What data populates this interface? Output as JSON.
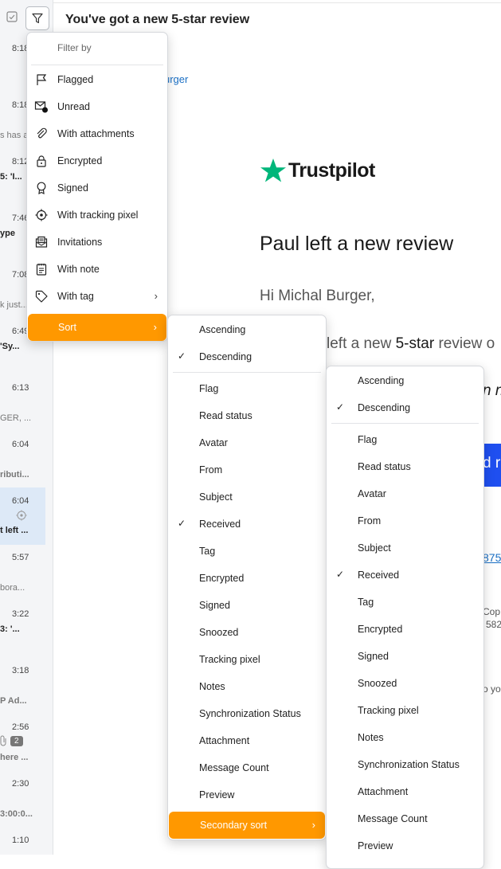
{
  "list": {
    "times": [
      "8:18",
      "8:18",
      "8:12",
      "7:46",
      "7:08",
      "6:49",
      "6:13",
      "6:04",
      "6:04",
      "5:57",
      "3:22",
      "3:18",
      "2:56",
      "2:30",
      "1:10"
    ],
    "snippets": [
      "s has a...",
      "5: 'I...",
      "ype",
      "k just...",
      "'Sy...",
      "GER, ...",
      "ributi...",
      "t left ...",
      "bora...",
      "3: '...",
      "P Ad...",
      "here ...",
      "3:00:0..."
    ],
    "badge": "2"
  },
  "reading_pane": {
    "subject": "You've got a new 5-star review",
    "link_fragment": "urger",
    "brand": "Trustpilot",
    "heading": "Paul left a new review",
    "greeting": "Hi Michal Burger,",
    "line1_a": "left a new ",
    "line1_b": "5-star",
    "line1_c": " review o",
    "italic_fragment": "n n",
    "button_fragment": "d r",
    "link2_fragment": "875",
    "footer1": "Cop",
    "footer2": "582",
    "footer3": "o yo"
  },
  "filter_menu": {
    "header": "Filter by",
    "items": [
      {
        "label": "Flagged",
        "icon": "flag-icon"
      },
      {
        "label": "Unread",
        "icon": "unread-mail-icon"
      },
      {
        "label": "With attachments",
        "icon": "paperclip-icon"
      },
      {
        "label": "Encrypted",
        "icon": "lock-icon"
      },
      {
        "label": "Signed",
        "icon": "seal-icon"
      },
      {
        "label": "With tracking pixel",
        "icon": "target-icon"
      },
      {
        "label": "Invitations",
        "icon": "invitation-icon"
      },
      {
        "label": "With note",
        "icon": "note-icon"
      },
      {
        "label": "With tag",
        "icon": "tag-icon"
      }
    ],
    "sort_label": "Sort"
  },
  "sort_menu": {
    "order": [
      "Ascending",
      "Descending"
    ],
    "checked_order": "Descending",
    "fields": [
      "Flag",
      "Read status",
      "Avatar",
      "From",
      "Subject",
      "Received",
      "Tag",
      "Encrypted",
      "Signed",
      "Snoozed",
      "Tracking pixel",
      "Notes",
      "Synchronization Status",
      "Attachment",
      "Message Count",
      "Preview"
    ],
    "checked_field": "Received",
    "secondary_label": "Secondary sort"
  },
  "secondary_menu": {
    "order": [
      "Ascending",
      "Descending"
    ],
    "checked_order": "Descending",
    "fields": [
      "Flag",
      "Read status",
      "Avatar",
      "From",
      "Subject",
      "Received",
      "Tag",
      "Encrypted",
      "Signed",
      "Snoozed",
      "Tracking pixel",
      "Notes",
      "Synchronization Status",
      "Attachment",
      "Message Count",
      "Preview"
    ],
    "checked_field": "Received"
  },
  "colors": {
    "accent": "#ff9800",
    "trustpilot_green": "#00b67a",
    "link": "#1a6fc4",
    "cta_blue": "#1f4ff0"
  }
}
